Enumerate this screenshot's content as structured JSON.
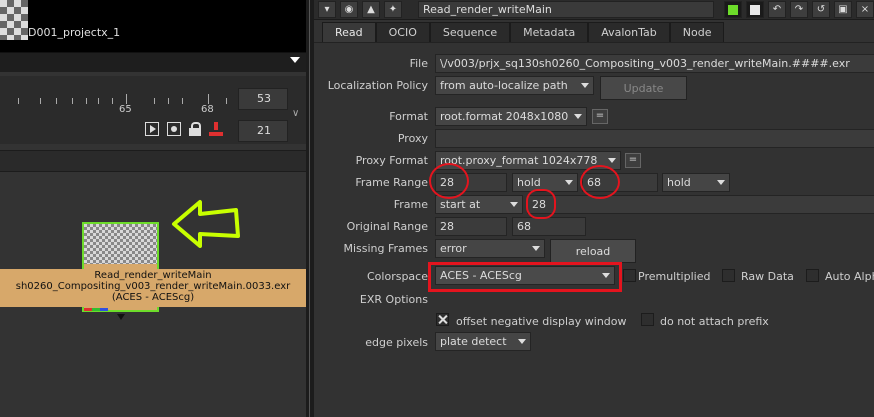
{
  "left_pane": {
    "project_name": "D001_projectx_1",
    "timeline": {
      "tick_labels": [
        "65",
        "68"
      ],
      "last_frame": "53",
      "current_frame": "21"
    },
    "node": {
      "line1": "Read_render_writeMain",
      "line2": "sh0260_Compositing_v003_render_writeMain.0033.exr",
      "line3": "(ACES - ACEScg)",
      "border_color": "#6ddc2a",
      "body_color": "#d7a86a"
    },
    "annotation_arrow_color": "#c8ff00"
  },
  "toolbar": {
    "node_name": "Read_render_writeMain"
  },
  "tabs": [
    "Read",
    "OCIO",
    "Sequence",
    "Metadata",
    "AvalonTab",
    "Node"
  ],
  "active_tab": "Read",
  "params": {
    "file": {
      "label": "File",
      "value": "\\/v003/prjx_sq130sh0260_Compositing_v003_render_writeMain.####.exr"
    },
    "localization": {
      "label": "Localization Policy",
      "value": "from auto-localize path",
      "button": "Update"
    },
    "format": {
      "label": "Format",
      "value": "root.format 2048x1080",
      "eq": "="
    },
    "proxy": {
      "label": "Proxy",
      "value": ""
    },
    "proxy_format": {
      "label": "Proxy Format",
      "value": "root.proxy_format 1024x778",
      "eq": "="
    },
    "frame_range": {
      "label": "Frame Range",
      "first": "28",
      "before": "hold",
      "last": "68",
      "after": "hold"
    },
    "frame": {
      "label": "Frame",
      "mode": "start at",
      "value": "28"
    },
    "original_range": {
      "label": "Original Range",
      "first": "28",
      "last": "68"
    },
    "missing_frames": {
      "label": "Missing Frames",
      "value": "error",
      "button": "reload"
    },
    "colorspace": {
      "label": "Colorspace",
      "value": "ACES - ACEScg",
      "premultiplied": "Premultiplied",
      "raw_data": "Raw Data",
      "auto_alpha": "Auto Alpha"
    },
    "exr_options": {
      "label": "EXR Options"
    },
    "offset_negative": {
      "label": "offset negative display window",
      "checked": true
    },
    "no_prefix": {
      "label": "do not attach prefix",
      "checked": false
    },
    "edge_pixels": {
      "label": "edge pixels",
      "value": "plate detect"
    }
  },
  "highlight_color": "#e4141e"
}
